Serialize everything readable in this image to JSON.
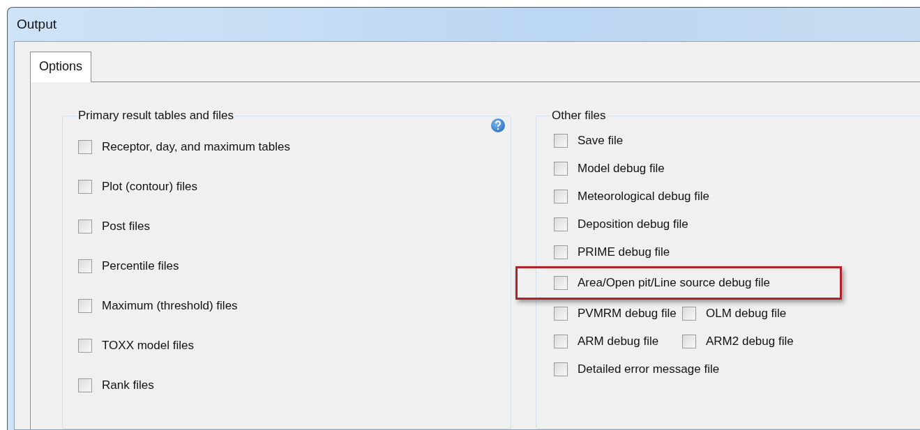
{
  "window": {
    "title": "Output"
  },
  "tabs": [
    {
      "label": "Options",
      "selected": true
    }
  ],
  "primary": {
    "title": "Primary result tables and files",
    "items": [
      {
        "label": "Receptor, day, and maximum tables",
        "checked": false
      },
      {
        "label": "Plot (contour) files",
        "checked": false
      },
      {
        "label": "Post files",
        "checked": false
      },
      {
        "label": "Percentile files",
        "checked": false
      },
      {
        "label": "Maximum (threshold) files",
        "checked": false
      },
      {
        "label": "TOXX model files",
        "checked": false
      },
      {
        "label": "Rank files",
        "checked": false
      }
    ]
  },
  "other": {
    "title": "Other files",
    "rows": [
      {
        "highlighted": false,
        "items": [
          {
            "label": "Save file",
            "checked": false
          }
        ]
      },
      {
        "highlighted": false,
        "items": [
          {
            "label": "Model debug file",
            "checked": false
          }
        ]
      },
      {
        "highlighted": false,
        "items": [
          {
            "label": "Meteorological debug file",
            "checked": false
          }
        ]
      },
      {
        "highlighted": false,
        "items": [
          {
            "label": "Deposition debug file",
            "checked": false
          }
        ]
      },
      {
        "highlighted": false,
        "items": [
          {
            "label": "PRIME debug file",
            "checked": false
          }
        ]
      },
      {
        "highlighted": true,
        "items": [
          {
            "label": "Area/Open pit/Line source debug file",
            "checked": false
          }
        ]
      },
      {
        "highlighted": false,
        "items": [
          {
            "label": "PVMRM debug file",
            "checked": false
          },
          {
            "label": "OLM debug file",
            "checked": false
          }
        ]
      },
      {
        "highlighted": false,
        "items": [
          {
            "label": "ARM debug file",
            "checked": false
          },
          {
            "label": "ARM2 debug file",
            "checked": false
          }
        ]
      },
      {
        "highlighted": false,
        "items": [
          {
            "label": "Detailed error message file",
            "checked": false
          }
        ]
      }
    ]
  }
}
